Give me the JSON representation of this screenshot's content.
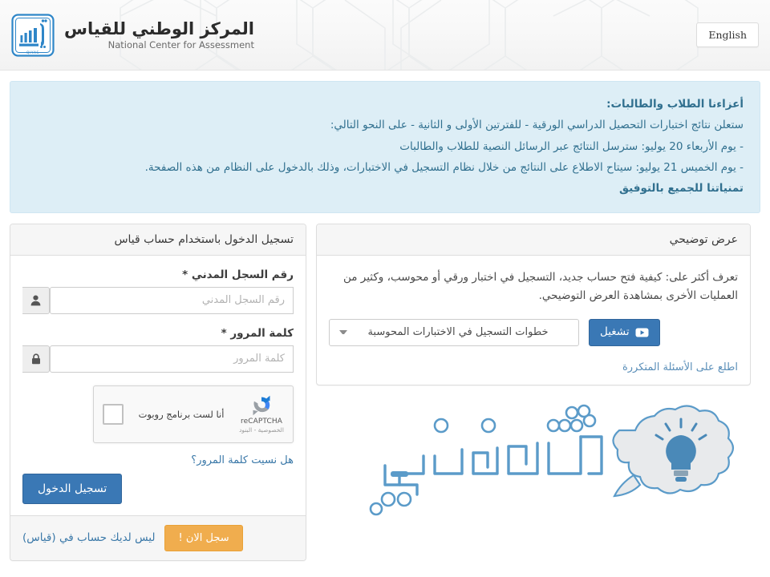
{
  "header": {
    "lang_button": "English",
    "brand_ar": "المركز الوطني للقياس",
    "brand_en": "National Center for Assessment",
    "logo_mark": "قياس",
    "logo_sub": "QIYAS",
    "logo_color": "#2e86c8"
  },
  "announcement": {
    "lines": [
      {
        "text": "أعزاءنا الطلاب والطالبات:",
        "bold": true
      },
      {
        "text": "ستعلن نتائج اختبارات التحصيل الدراسي الورقية - للفترتين الأولى و الثانية - على النحو التالي:",
        "bold": false
      },
      {
        "text": "- يوم الأربعاء 20 يوليو: سترسل النتائج عبر الرسائل النصية للطلاب والطالبات",
        "bold": false
      },
      {
        "text": "- يوم الخميس 21 يوليو: سيتاح الاطلاع على النتائج من خلال نظام التسجيل في الاختبارات، وذلك بالدخول على النظام من هذه الصفحة.",
        "bold": false
      },
      {
        "text": "تمنياتنا للجميع بالتوفيق",
        "bold": true
      }
    ],
    "background_color": "#ddeef6",
    "text_color": "#31708f"
  },
  "login_panel": {
    "title": "تسجيل الدخول باستخدام حساب قياس",
    "civil_id": {
      "label": "رقم السجل المدني *",
      "placeholder": "رقم السجل المدني",
      "value": "",
      "icon": "user-icon"
    },
    "password": {
      "label": "كلمة المرور *",
      "placeholder": "كلمة المرور",
      "value": "",
      "icon": "lock-icon"
    },
    "recaptcha": {
      "label": "أنا لست برنامج روبوت",
      "brand": "reCAPTCHA",
      "terms": "الخصوصية - البنود",
      "checked": false
    },
    "forgot_link": "هل نسيت كلمة المرور؟",
    "submit_button": "تسجيل الدخول",
    "submit_color": "#3a78b5",
    "footer_text": "ليس لديك حساب في (قياس)",
    "register_button": "سجل الان !",
    "register_color": "#f0ad4e"
  },
  "demo_panel": {
    "title": "عرض توضيحي",
    "description": "تعرف أكثر على: كيفية فتح حساب جديد، التسجيل في اختبار ورقي أو محوسب، وكثير من العمليات الأخرى بمشاهدة العرض التوضيحي.",
    "select_value": "خطوات التسجيل في الاختبارات المحوسبة",
    "play_button": "تشغيل",
    "faq_link": "اطلع على الأسئلة المتكررة"
  },
  "illustration": {
    "wordmark": "ثقفني",
    "bulb_color": "#4a89b8",
    "bubble_color": "#e8eaec"
  }
}
